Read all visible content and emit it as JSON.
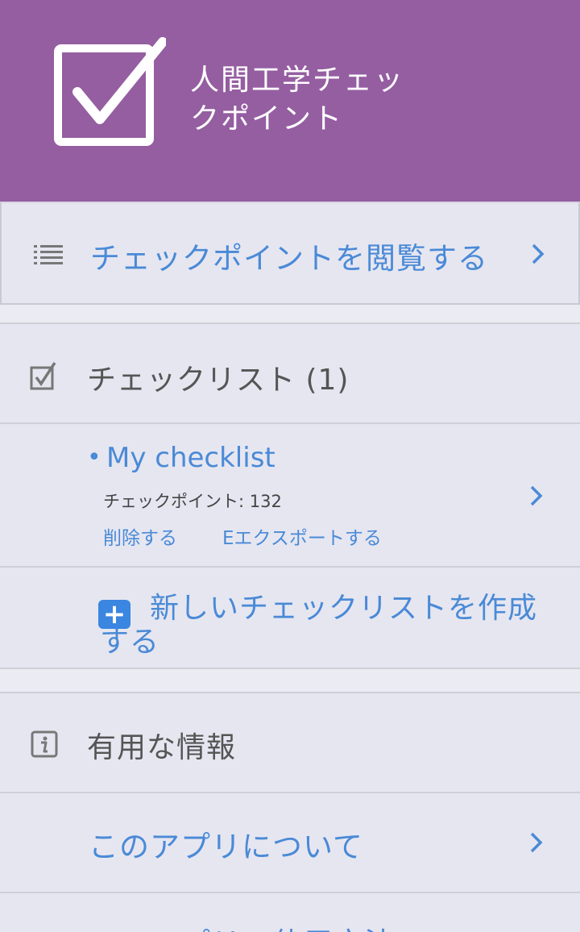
{
  "header": {
    "title": "人間工学チェックポイント",
    "background_color": "#955ea1"
  },
  "browse": {
    "label": "チェックポイントを閲覧する",
    "icon": "list-icon"
  },
  "checklists": {
    "label": "チェックリスト (1)",
    "icon": "checkbox-icon",
    "items": [
      {
        "name": "My checklist",
        "count_text": "チェックポイント: 132",
        "delete_label": "削除する",
        "export_label": "Eエクスポートする"
      }
    ],
    "new_label": "新しいチェックリストを作成する",
    "new_icon": "plus-icon"
  },
  "info": {
    "label": "有用な情報",
    "icon": "info-icon",
    "items": [
      {
        "label": "このアプリについて"
      },
      {
        "label": "このアプリの使用方法"
      }
    ]
  },
  "colors": {
    "accent": "#4a8ad6",
    "background": "#e6e6f1",
    "plus_button": "#3a86e0"
  }
}
